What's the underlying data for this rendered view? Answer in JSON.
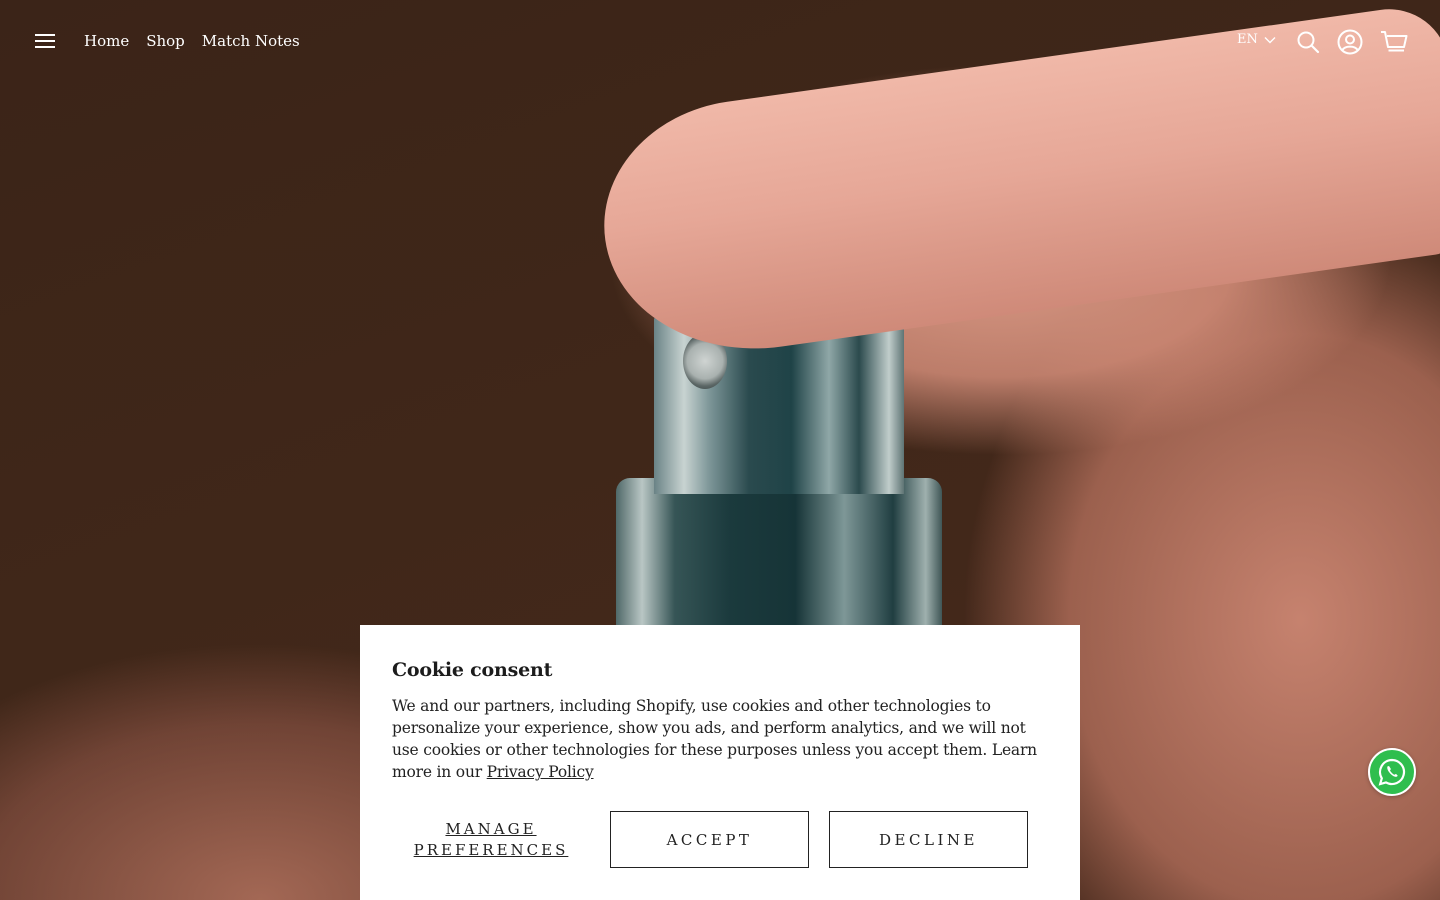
{
  "header": {
    "menu_icon": "hamburger-icon",
    "nav": [
      {
        "label": "Home"
      },
      {
        "label": "Shop"
      },
      {
        "label": "Match Notes"
      }
    ],
    "language": "EN",
    "icons": [
      "search-icon",
      "account-icon",
      "cart-icon"
    ]
  },
  "hero": {
    "image": "finger pressing perfume sprayer close-up"
  },
  "cookie": {
    "title": "Cookie consent",
    "body": "We and our partners, including Shopify, use cookies and other technologies to personalize your experience, show you ads, and perform analytics, and we will not use cookies or other technologies for these purposes unless you accept them. Learn more in our",
    "privacy_link": "Privacy Policy",
    "manage_label": "MANAGE PREFERENCES",
    "accept_label": "ACCEPT",
    "decline_label": "DECLINE"
  },
  "whatsapp": {
    "icon": "whatsapp-icon",
    "color": "#2fbe4e"
  }
}
